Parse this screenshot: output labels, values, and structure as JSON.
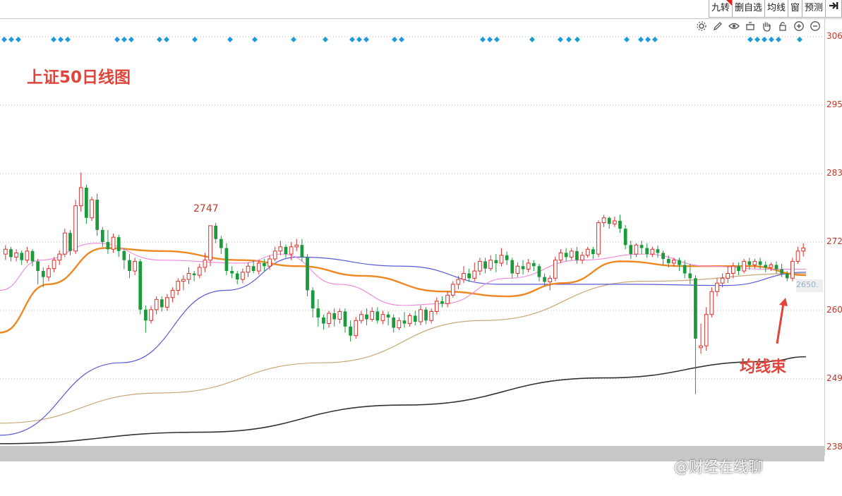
{
  "toolbar": {
    "buttons": [
      "九转",
      "删自选",
      "均线",
      "窗",
      "预测"
    ],
    "arrow_icon": "collapse-right-icon"
  },
  "tool_icons": [
    "settings-icon",
    "pencil-icon",
    "eye-icon",
    "basket-icon",
    "hand-icon",
    "lock-icon",
    "zoom-in-icon",
    "zoom-out-icon"
  ],
  "title": "上证50日线图",
  "annotation": "均线束",
  "peak_label": "2747",
  "price_tag": "2650.",
  "watermark": "@财经在线聊",
  "colors": {
    "up": "#e0302a",
    "down": "#1a9a3a",
    "diamond": "#1e9bd7",
    "text_red": "#e0443a"
  },
  "chart_data": {
    "type": "candlestick",
    "y_tick_labels": [
      "306",
      "295",
      "283",
      "272",
      "260",
      "249",
      "238"
    ],
    "ylim": [
      2380,
      3060
    ],
    "grid": "horizontal dotted",
    "signal_markers_count": 40,
    "candles": [
      [
        2700,
        2708,
        2690,
        2715
      ],
      [
        2708,
        2695,
        2688,
        2712
      ],
      [
        2695,
        2702,
        2688,
        2708
      ],
      [
        2702,
        2690,
        2682,
        2706
      ],
      [
        2690,
        2705,
        2685,
        2712
      ],
      [
        2705,
        2688,
        2680,
        2708
      ],
      [
        2688,
        2672,
        2650,
        2692
      ],
      [
        2672,
        2662,
        2645,
        2678
      ],
      [
        2662,
        2676,
        2655,
        2682
      ],
      [
        2676,
        2690,
        2670,
        2695
      ],
      [
        2690,
        2700,
        2682,
        2706
      ],
      [
        2700,
        2735,
        2695,
        2742
      ],
      [
        2735,
        2705,
        2698,
        2740
      ],
      [
        2705,
        2780,
        2700,
        2790
      ],
      [
        2780,
        2810,
        2770,
        2835
      ],
      [
        2810,
        2760,
        2750,
        2815
      ],
      [
        2760,
        2790,
        2755,
        2795
      ],
      [
        2790,
        2740,
        2730,
        2800
      ],
      [
        2740,
        2720,
        2712,
        2745
      ],
      [
        2720,
        2708,
        2700,
        2740
      ],
      [
        2708,
        2728,
        2702,
        2734
      ],
      [
        2728,
        2705,
        2695,
        2732
      ],
      [
        2705,
        2690,
        2675,
        2710
      ],
      [
        2690,
        2672,
        2660,
        2700
      ],
      [
        2672,
        2688,
        2665,
        2694
      ],
      [
        2688,
        2608,
        2600,
        2692
      ],
      [
        2608,
        2590,
        2570,
        2615
      ],
      [
        2590,
        2608,
        2585,
        2614
      ],
      [
        2608,
        2625,
        2600,
        2630
      ],
      [
        2625,
        2612,
        2605,
        2630
      ],
      [
        2612,
        2628,
        2606,
        2634
      ],
      [
        2628,
        2640,
        2620,
        2645
      ],
      [
        2640,
        2655,
        2632,
        2660
      ],
      [
        2655,
        2658,
        2640,
        2665
      ],
      [
        2658,
        2668,
        2650,
        2678
      ],
      [
        2668,
        2665,
        2655,
        2672
      ],
      [
        2665,
        2678,
        2660,
        2684
      ],
      [
        2678,
        2690,
        2670,
        2702
      ],
      [
        2690,
        2747,
        2680,
        2747
      ],
      [
        2747,
        2725,
        2718,
        2752
      ],
      [
        2725,
        2710,
        2700,
        2730
      ],
      [
        2710,
        2672,
        2665,
        2718
      ],
      [
        2672,
        2668,
        2660,
        2680
      ],
      [
        2668,
        2658,
        2650,
        2672
      ],
      [
        2658,
        2670,
        2652,
        2676
      ],
      [
        2670,
        2680,
        2662,
        2686
      ],
      [
        2680,
        2672,
        2668,
        2690
      ],
      [
        2672,
        2685,
        2666,
        2690
      ],
      [
        2685,
        2680,
        2672,
        2692
      ],
      [
        2680,
        2692,
        2674,
        2698
      ],
      [
        2692,
        2705,
        2688,
        2712
      ],
      [
        2705,
        2712,
        2698,
        2722
      ],
      [
        2712,
        2700,
        2694,
        2716
      ],
      [
        2700,
        2712,
        2690,
        2720
      ],
      [
        2712,
        2715,
        2705,
        2725
      ],
      [
        2715,
        2695,
        2688,
        2725
      ],
      [
        2695,
        2640,
        2630,
        2700
      ],
      [
        2640,
        2610,
        2595,
        2645
      ],
      [
        2610,
        2595,
        2580,
        2625
      ],
      [
        2595,
        2585,
        2575,
        2600
      ],
      [
        2585,
        2602,
        2578,
        2606
      ],
      [
        2602,
        2592,
        2580,
        2610
      ],
      [
        2592,
        2605,
        2585,
        2610
      ],
      [
        2605,
        2580,
        2570,
        2610
      ],
      [
        2580,
        2565,
        2555,
        2590
      ],
      [
        2565,
        2590,
        2560,
        2596
      ],
      [
        2590,
        2600,
        2585,
        2606
      ],
      [
        2600,
        2592,
        2582,
        2610
      ],
      [
        2592,
        2605,
        2588,
        2612
      ],
      [
        2605,
        2590,
        2585,
        2612
      ],
      [
        2590,
        2600,
        2584,
        2606
      ],
      [
        2600,
        2595,
        2582,
        2605
      ],
      [
        2595,
        2578,
        2570,
        2600
      ],
      [
        2578,
        2590,
        2574,
        2595
      ],
      [
        2590,
        2585,
        2578,
        2604
      ],
      [
        2585,
        2598,
        2580,
        2602
      ],
      [
        2598,
        2588,
        2582,
        2606
      ],
      [
        2588,
        2608,
        2582,
        2615
      ],
      [
        2608,
        2590,
        2584,
        2612
      ],
      [
        2590,
        2605,
        2585,
        2610
      ],
      [
        2605,
        2622,
        2600,
        2628
      ],
      [
        2622,
        2618,
        2612,
        2630
      ],
      [
        2618,
        2632,
        2612,
        2638
      ],
      [
        2632,
        2650,
        2628,
        2655
      ],
      [
        2650,
        2658,
        2642,
        2664
      ],
      [
        2658,
        2668,
        2652,
        2680
      ],
      [
        2668,
        2660,
        2654,
        2676
      ],
      [
        2660,
        2672,
        2655,
        2686
      ],
      [
        2672,
        2688,
        2665,
        2694
      ],
      [
        2688,
        2676,
        2668,
        2694
      ],
      [
        2676,
        2690,
        2672,
        2698
      ],
      [
        2690,
        2685,
        2670,
        2700
      ],
      [
        2685,
        2698,
        2680,
        2710
      ],
      [
        2698,
        2690,
        2682,
        2704
      ],
      [
        2690,
        2668,
        2660,
        2694
      ],
      [
        2668,
        2680,
        2662,
        2686
      ],
      [
        2680,
        2675,
        2666,
        2690
      ],
      [
        2675,
        2685,
        2670,
        2692
      ],
      [
        2685,
        2680,
        2672,
        2690
      ],
      [
        2680,
        2662,
        2655,
        2684
      ],
      [
        2662,
        2654,
        2648,
        2668
      ],
      [
        2654,
        2660,
        2640,
        2665
      ],
      [
        2660,
        2690,
        2655,
        2696
      ],
      [
        2690,
        2702,
        2685,
        2708
      ],
      [
        2702,
        2695,
        2688,
        2710
      ],
      [
        2695,
        2705,
        2690,
        2710
      ],
      [
        2705,
        2690,
        2684,
        2712
      ],
      [
        2690,
        2698,
        2684,
        2704
      ],
      [
        2698,
        2708,
        2694,
        2712
      ],
      [
        2708,
        2700,
        2692,
        2712
      ],
      [
        2700,
        2752,
        2695,
        2756
      ],
      [
        2752,
        2760,
        2745,
        2765
      ],
      [
        2760,
        2750,
        2742,
        2762
      ],
      [
        2750,
        2755,
        2745,
        2762
      ],
      [
        2755,
        2742,
        2735,
        2765
      ],
      [
        2742,
        2715,
        2708,
        2748
      ],
      [
        2715,
        2700,
        2692,
        2722
      ],
      [
        2700,
        2715,
        2695,
        2718
      ],
      [
        2715,
        2710,
        2700,
        2722
      ],
      [
        2710,
        2700,
        2694,
        2718
      ],
      [
        2700,
        2708,
        2695,
        2712
      ],
      [
        2708,
        2702,
        2694,
        2714
      ],
      [
        2702,
        2692,
        2682,
        2706
      ],
      [
        2692,
        2685,
        2678,
        2698
      ],
      [
        2685,
        2690,
        2680,
        2694
      ],
      [
        2690,
        2682,
        2672,
        2694
      ],
      [
        2682,
        2668,
        2660,
        2690
      ],
      [
        2668,
        2660,
        2650,
        2684
      ],
      [
        2660,
        2560,
        2468,
        2665
      ],
      [
        2545,
        2548,
        2535,
        2585
      ],
      [
        2548,
        2600,
        2540,
        2612
      ],
      [
        2600,
        2638,
        2595,
        2645
      ],
      [
        2638,
        2652,
        2630,
        2660
      ],
      [
        2652,
        2660,
        2645,
        2668
      ],
      [
        2660,
        2668,
        2652,
        2680
      ],
      [
        2668,
        2680,
        2660,
        2686
      ],
      [
        2680,
        2672,
        2665,
        2686
      ],
      [
        2672,
        2688,
        2668,
        2692
      ],
      [
        2688,
        2682,
        2674,
        2694
      ],
      [
        2682,
        2688,
        2676,
        2692
      ],
      [
        2688,
        2682,
        2675,
        2694
      ],
      [
        2682,
        2678,
        2670,
        2688
      ],
      [
        2678,
        2682,
        2672,
        2686
      ],
      [
        2682,
        2675,
        2668,
        2688
      ],
      [
        2675,
        2668,
        2662,
        2684
      ],
      [
        2668,
        2660,
        2655,
        2672
      ],
      [
        2660,
        2688,
        2655,
        2694
      ],
      [
        2688,
        2705,
        2684,
        2712
      ],
      [
        2705,
        2710,
        2696,
        2718
      ]
    ],
    "moving_averages": [
      {
        "color": "#333333",
        "width": 1.6,
        "points": [
          [
            0,
            2386
          ],
          [
            0.25,
            2405
          ],
          [
            0.5,
            2450
          ],
          [
            0.75,
            2495
          ],
          [
            0.95,
            2522
          ],
          [
            1,
            2530
          ]
        ]
      },
      {
        "color": "#c8a878",
        "width": 1.2,
        "points": [
          [
            0,
            2420
          ],
          [
            0.2,
            2470
          ],
          [
            0.4,
            2520
          ],
          [
            0.6,
            2590
          ],
          [
            0.8,
            2655
          ],
          [
            1,
            2668
          ]
        ]
      },
      {
        "color": "#5a5ad8",
        "width": 1.2,
        "points": [
          [
            0,
            2400
          ],
          [
            0.15,
            2520
          ],
          [
            0.28,
            2640
          ],
          [
            0.37,
            2695
          ],
          [
            0.5,
            2680
          ],
          [
            0.62,
            2650
          ],
          [
            0.78,
            2650
          ],
          [
            0.9,
            2648
          ],
          [
            1,
            2670
          ]
        ]
      },
      {
        "color": "#ee8822",
        "width": 2.4,
        "points": [
          [
            0,
            2570
          ],
          [
            0.06,
            2650
          ],
          [
            0.13,
            2710
          ],
          [
            0.2,
            2705
          ],
          [
            0.3,
            2690
          ],
          [
            0.37,
            2680
          ],
          [
            0.45,
            2664
          ],
          [
            0.55,
            2638
          ],
          [
            0.63,
            2630
          ],
          [
            0.7,
            2652
          ],
          [
            0.77,
            2688
          ],
          [
            0.85,
            2680
          ],
          [
            0.93,
            2680
          ],
          [
            1,
            2665
          ]
        ]
      },
      {
        "color": "#ee88dd",
        "width": 1.1,
        "points": [
          [
            0,
            2640
          ],
          [
            0.05,
            2690
          ],
          [
            0.12,
            2718
          ],
          [
            0.2,
            2690
          ],
          [
            0.3,
            2685
          ],
          [
            0.35,
            2700
          ],
          [
            0.42,
            2650
          ],
          [
            0.5,
            2615
          ],
          [
            0.55,
            2618
          ],
          [
            0.63,
            2660
          ],
          [
            0.72,
            2690
          ],
          [
            0.8,
            2700
          ],
          [
            0.88,
            2680
          ],
          [
            0.95,
            2675
          ],
          [
            1,
            2675
          ]
        ]
      }
    ]
  }
}
